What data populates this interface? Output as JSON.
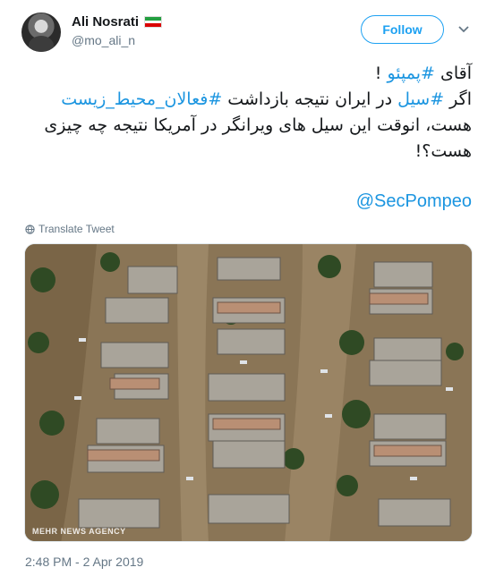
{
  "user": {
    "display_name": "Ali Nosrati",
    "handle": "@mo_ali_n",
    "flag_icon": "iran-flag-icon"
  },
  "follow_label": "Follow",
  "menu_icon": "chevron-down-icon",
  "tweet": {
    "line1_prefix": "آقای ",
    "line1_hashtag": "#پمپئو",
    "line1_suffix": " !",
    "line2_a": "اگر ",
    "line2_hashtag1": "#سیل",
    "line2_b": " در ایران نتیجه بازداشت ",
    "line2_hashtag2": "#فعالان_محیط_زیست",
    "line3": "هست، انوقت این سیل های ویرانگر در آمریکا نتیجه چه چیزی هست؟!",
    "mention": "@SecPompeo"
  },
  "translate_label": "Translate Tweet",
  "media": {
    "watermark": "MEHR NEWS AGENCY",
    "description_icon": "flood-photo"
  },
  "timestamp": "2:48 PM - 2 Apr 2019",
  "colors": {
    "link": "#1b95e0",
    "follow": "#1da1f2",
    "muted": "#657786"
  }
}
